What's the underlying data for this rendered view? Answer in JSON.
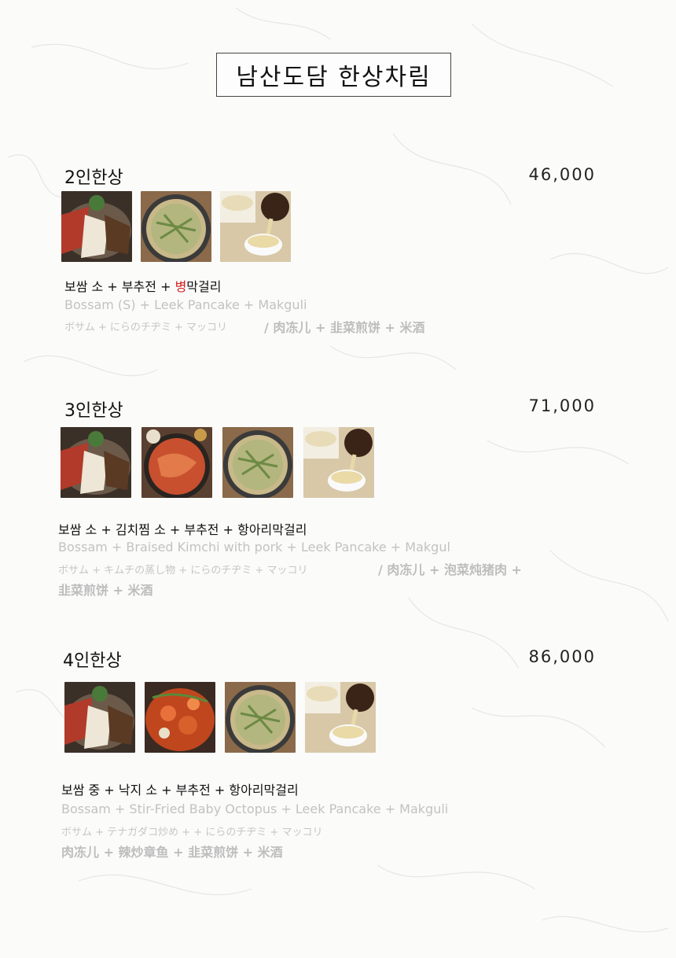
{
  "title": "남산도담 한상차림",
  "sections": [
    {
      "name": "2인한상",
      "price": "46,000",
      "thumbs": [
        "bossam-icon",
        "leek-pancake-icon",
        "makgeolli-icon"
      ],
      "ko_a": "보쌈 소 + 부추전 + ",
      "ko_red": "병",
      "ko_b": "막걸리",
      "en": "Bossam (S)  +  Leek Pancake   + Makguli",
      "jp": "ボサム +    にらのチヂミ + マッコリ",
      "zh": "/    肉冻儿  +   韭菜煎饼  + 米酒"
    },
    {
      "name": "3인한상",
      "price": "71,000",
      "thumbs": [
        "bossam-icon",
        "braised-kimchi-icon",
        "leek-pancake-icon",
        "makgeolli-icon"
      ],
      "ko": "보쌈 소 + 김치찜 소  + 부추전 + 항아리막걸리",
      "en": "Bossam  +  Braised Kimchi with pork  + Leek Pancake   + Makgul",
      "jp": "ボサム  +   キムチの蒸し物  +   にらのチヂミ + マッコリ",
      "zh1": "/    肉冻儿 +    泡菜炖猪肉  +",
      "zh2": "韭菜煎饼  +  米酒"
    },
    {
      "name": "4인한상",
      "price": "86,000",
      "thumbs": [
        "bossam-icon",
        "stir-fried-octopus-icon",
        "leek-pancake-icon",
        "makgeolli-icon"
      ],
      "ko": "보쌈 중 + 낙지 소 + 부추전 +   항아리막걸리",
      "en": "Bossam + Stir-Fried Baby Octopus  +  Leek Pancake   +  Makguli",
      "jp": "ボサム +  テナガダコ炒め  +   +   にらのチヂミ +   マッコリ",
      "zh": "肉冻儿   +    辣炒章鱼  +    韭菜煎饼   +  米酒"
    }
  ],
  "colors": {
    "text": "#111111",
    "accent_red": "#d11a1a",
    "muted": "#c2c2c2"
  }
}
